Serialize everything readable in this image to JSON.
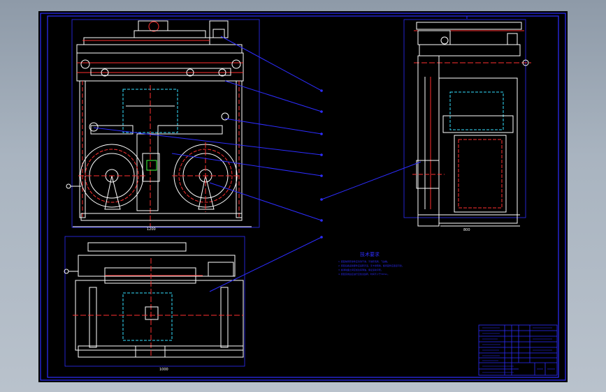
{
  "drawing": {
    "type": "CAD mechanical assembly drawing",
    "background": "#000000",
    "colors": {
      "frame": "#2d2dff",
      "line": "#ffffff",
      "red": "#ff3030",
      "cyan": "#33e0ff",
      "green": "#40ff40",
      "yellow": "#ffff40",
      "magenta": "#ff40ff"
    },
    "tech_title": "技术要求",
    "tech_notes": [
      "1. 装配前所有零件应清洗干净，不得有毛刺、飞边等。",
      "2. 装配后各运动部件应运转灵活，无卡滞现象，各紧固件应连接可靠。",
      "3. 各滑动面之间应加注润滑油，保证运动平稳。",
      "4. 装配完成后应进行空载试运转，时间不少于30min。"
    ],
    "title_block": {
      "rows": 9
    }
  }
}
